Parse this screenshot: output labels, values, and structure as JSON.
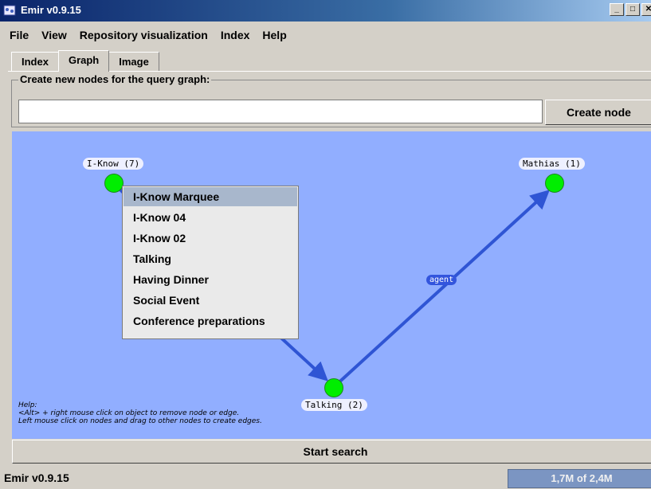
{
  "window": {
    "title": "Emir v0.9.15",
    "buttons": [
      "_",
      "□",
      "✕"
    ]
  },
  "menubar": [
    "File",
    "View",
    "Repository visualization",
    "Index",
    "Help"
  ],
  "tabs": [
    "Index",
    "Graph",
    "Image"
  ],
  "active_tab": "Graph",
  "create_nodes": {
    "legend": "Create new nodes for the query graph:",
    "input_value": "",
    "button_label": "Create node"
  },
  "graph": {
    "nodes": [
      {
        "label": "I-Know (7)"
      },
      {
        "label": "Mathias (1)"
      },
      {
        "label": "Talking (2)"
      }
    ],
    "edges": [
      {
        "from": "I-Know (7)",
        "to": "Talking (2)",
        "label": ""
      },
      {
        "from": "Talking (2)",
        "to": "Mathias (1)",
        "label": "agent"
      }
    ],
    "help": [
      "Help:",
      "<Alt> + right mouse click on object to remove node or edge.",
      "Left mouse click on nodes and drag to other nodes to create edges."
    ]
  },
  "popup_menu": {
    "items": [
      "I-Know Marquee",
      "I-Know 04",
      "I-Know 02",
      "Talking",
      "Having Dinner",
      "Social Event",
      "Conference preparations"
    ],
    "selected": "I-Know Marquee"
  },
  "start_button": "Start search",
  "status": {
    "text": "Emir v0.9.15",
    "memory": "1,7M of 2,4M"
  },
  "colors": {
    "canvas": "#91aeff",
    "node": "#00ee00",
    "edge": "#2f55d4",
    "title_bar": "#0a246a",
    "memory_bar": "#7b95c2"
  }
}
